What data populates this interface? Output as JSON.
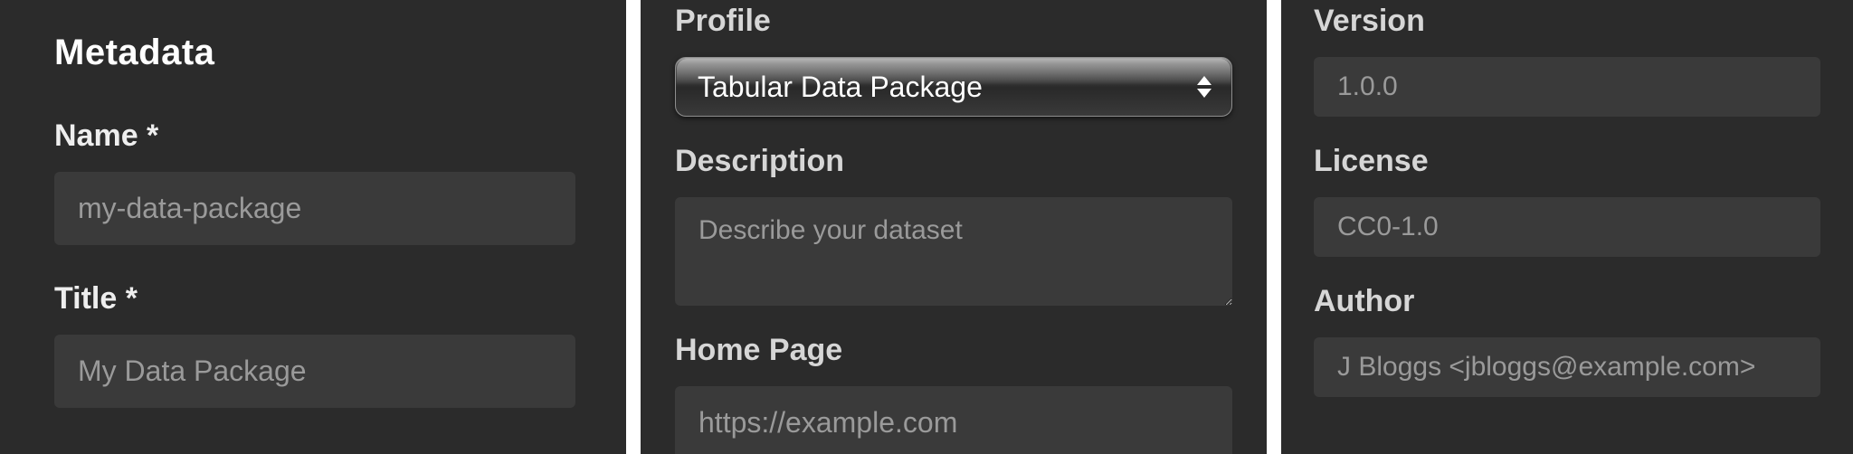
{
  "metadata": {
    "heading": "Metadata",
    "name": {
      "label": "Name *",
      "placeholder": "my-data-package",
      "value": ""
    },
    "title": {
      "label": "Title *",
      "placeholder": "My Data Package",
      "value": ""
    },
    "profile": {
      "label": "Profile",
      "selected": "Tabular Data Package"
    },
    "description": {
      "label": "Description",
      "placeholder": "Describe your dataset",
      "value": ""
    },
    "homepage": {
      "label": "Home Page",
      "placeholder": "https://example.com",
      "value": ""
    },
    "version": {
      "label": "Version",
      "placeholder": "1.0.0",
      "value": ""
    },
    "license": {
      "label": "License",
      "placeholder": "CC0-1.0",
      "value": ""
    },
    "author": {
      "label": "Author",
      "placeholder": "J Bloggs <jbloggs@example.com>",
      "value": ""
    }
  }
}
